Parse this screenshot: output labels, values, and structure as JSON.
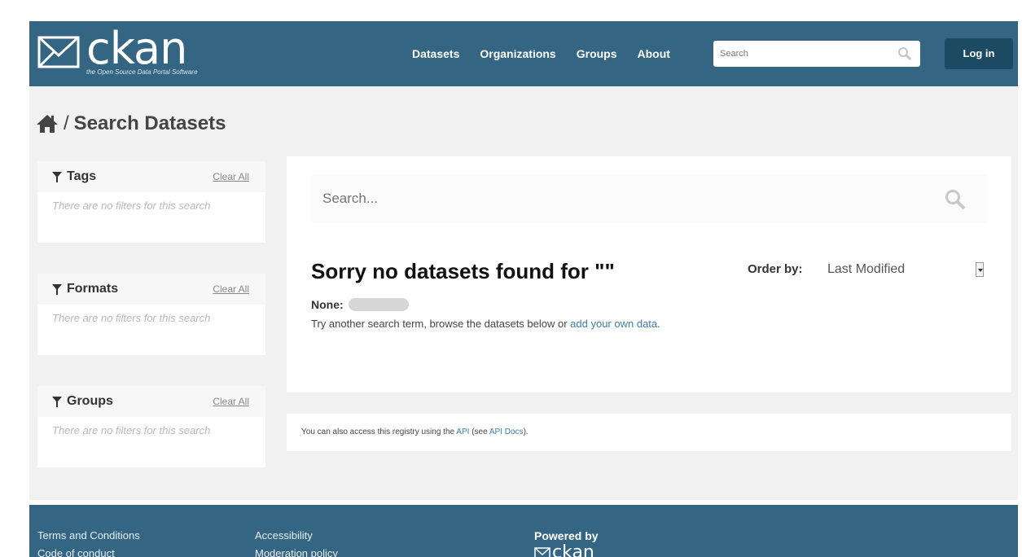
{
  "header": {
    "logo_text": "ckan",
    "logo_tagline": "the Open Source Data Portal Software",
    "nav": [
      "Datasets",
      "Organizations",
      "Groups",
      "About"
    ],
    "search_placeholder": "Search",
    "login_label": "Log in"
  },
  "breadcrumb": {
    "home_icon": "home-icon",
    "separator": "/",
    "current": "Search Datasets"
  },
  "facets": [
    {
      "title": "Tags",
      "clear_label": "Clear All",
      "empty_text": "There are no filters for this search"
    },
    {
      "title": "Formats",
      "clear_label": "Clear All",
      "empty_text": "There are no filters for this search"
    },
    {
      "title": "Groups",
      "clear_label": "Clear All",
      "empty_text": "There are no filters for this search"
    }
  ],
  "main": {
    "search_placeholder": "Search...",
    "no_results": "Sorry no datasets found for \"\"",
    "order_label": "Order by:",
    "order_value": "Last Modified",
    "none_label": "None:",
    "try_text": "Try another search term, browse the datasets below or ",
    "try_link": "add your own data",
    "try_end": "."
  },
  "api": {
    "prefix": "You can also access this registry using the ",
    "api_link": "API",
    "middle": " (see ",
    "docs_link": "API Docs",
    "suffix": ")."
  },
  "footer": {
    "links": [
      "Terms and Conditions",
      "Accessibility",
      "Code of conduct",
      "Moderation policy"
    ],
    "powered_by": "Powered by",
    "powered_logo": "ckan"
  },
  "colors": {
    "header_bg": "#346683",
    "login_bg": "#1d4a63",
    "link": "#3c7fa8",
    "content_bg": "#f1f1f1"
  }
}
